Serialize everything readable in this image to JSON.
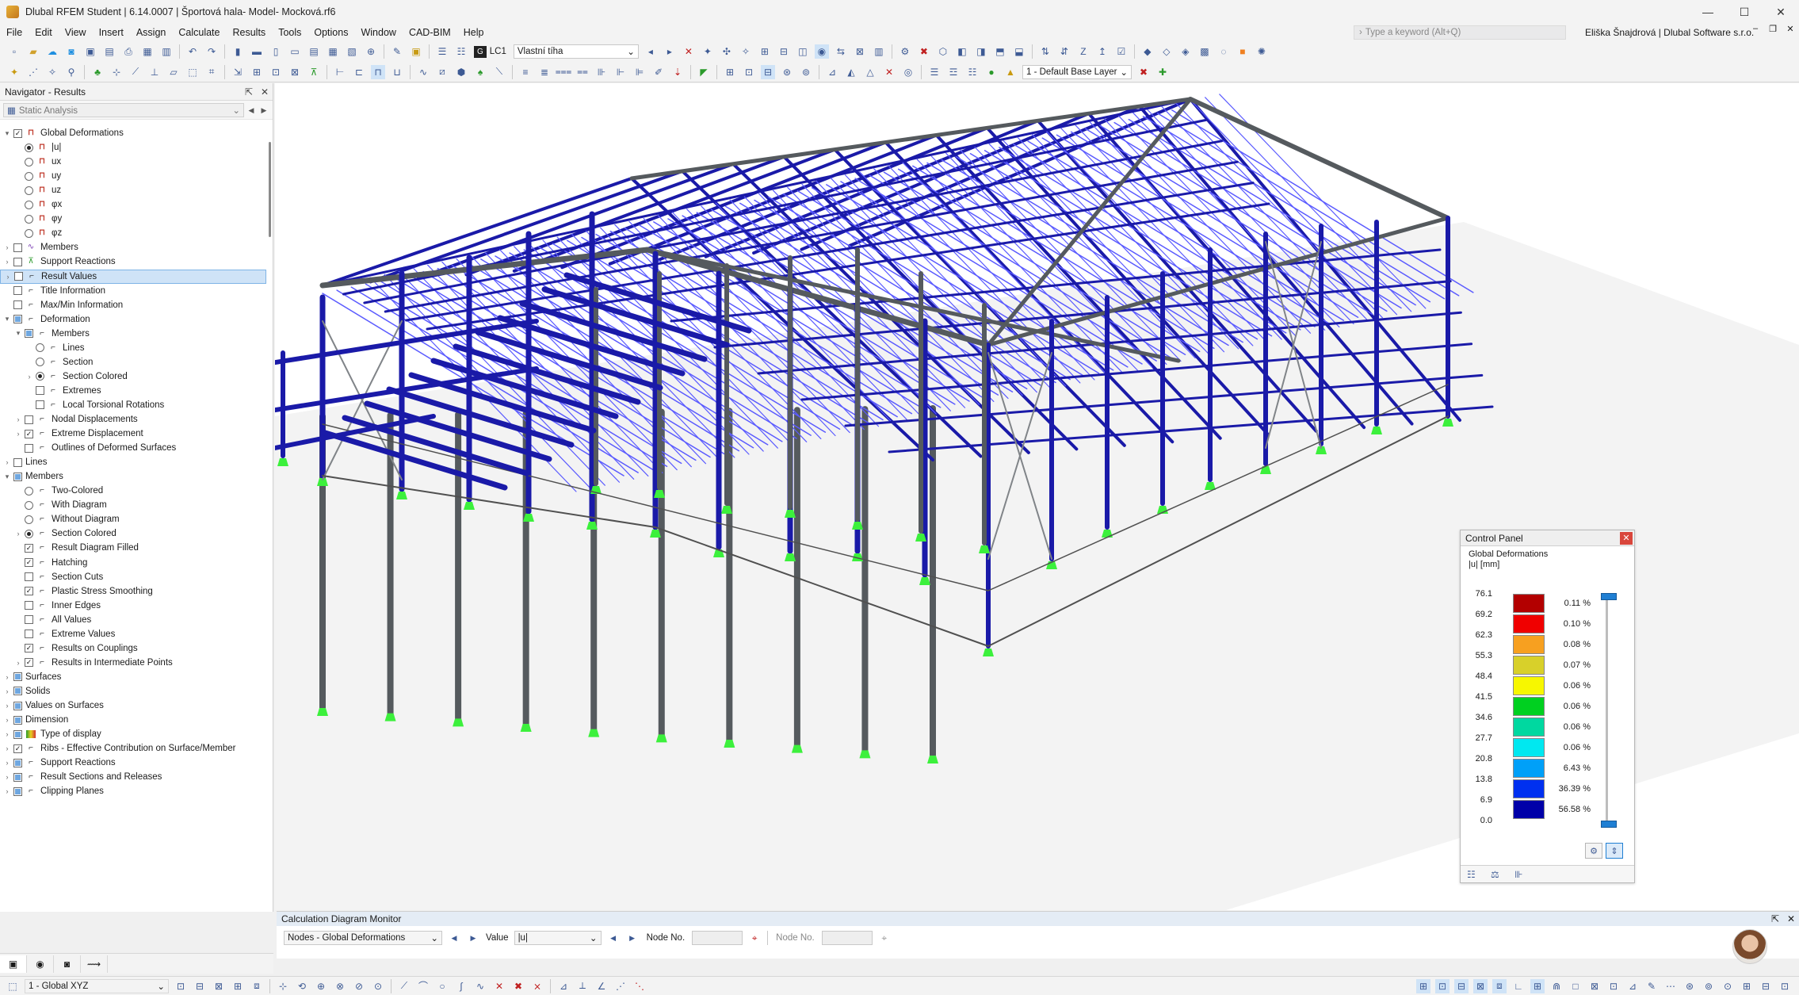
{
  "window": {
    "title": "Dlubal RFEM Student | 6.14.0007 | Športová hala- Model- Mocková.rf6",
    "controls": [
      "—",
      "☐",
      "✕"
    ]
  },
  "menu": [
    "File",
    "Edit",
    "View",
    "Insert",
    "Assign",
    "Calculate",
    "Results",
    "Tools",
    "Options",
    "Window",
    "CAD-BIM",
    "Help"
  ],
  "search": {
    "placeholder": "Type a keyword (Alt+Q)"
  },
  "user": "Eliška Šnajdrová | Dlubal Software s.r.o.",
  "toolbar": {
    "lc_badge": "G",
    "lc_code": "LC1",
    "lc_name": "Vlastní tíha",
    "layer": "1 - Default Base Layer"
  },
  "navigator": {
    "title": "Navigator - Results",
    "filter": "Static Analysis",
    "items": [
      {
        "level": 0,
        "exp": "▾",
        "ctl": "cb",
        "state": "on",
        "icon": "deform",
        "label": "Global Deformations"
      },
      {
        "level": 1,
        "exp": "",
        "ctl": "rb",
        "state": "on",
        "icon": "deform",
        "label": "|u|"
      },
      {
        "level": 1,
        "exp": "",
        "ctl": "rb",
        "state": "off",
        "icon": "deform",
        "label": "ux"
      },
      {
        "level": 1,
        "exp": "",
        "ctl": "rb",
        "state": "off",
        "icon": "deform",
        "label": "uy"
      },
      {
        "level": 1,
        "exp": "",
        "ctl": "rb",
        "state": "off",
        "icon": "deform",
        "label": "uz"
      },
      {
        "level": 1,
        "exp": "",
        "ctl": "rb",
        "state": "off",
        "icon": "deform",
        "label": "φx"
      },
      {
        "level": 1,
        "exp": "",
        "ctl": "rb",
        "state": "off",
        "icon": "deform",
        "label": "φy"
      },
      {
        "level": 1,
        "exp": "",
        "ctl": "rb",
        "state": "off",
        "icon": "deform",
        "label": "φz"
      },
      {
        "level": 0,
        "exp": "›",
        "ctl": "cb",
        "state": "off",
        "icon": "member",
        "label": "Members"
      },
      {
        "level": 0,
        "exp": "›",
        "ctl": "cb",
        "state": "off",
        "icon": "support",
        "label": "Support Reactions"
      },
      {
        "level": 0,
        "exp": "›",
        "ctl": "cb",
        "state": "off",
        "icon": "generic",
        "label": "Result Values",
        "hl": true
      },
      {
        "level": 0,
        "exp": "",
        "ctl": "cb",
        "state": "off",
        "icon": "generic",
        "label": "Title Information"
      },
      {
        "level": 0,
        "exp": "",
        "ctl": "cb",
        "state": "off",
        "icon": "generic",
        "label": "Max/Min Information"
      },
      {
        "level": 0,
        "exp": "▾",
        "ctl": "cb",
        "state": "part",
        "icon": "generic",
        "label": "Deformation"
      },
      {
        "level": 1,
        "exp": "▾",
        "ctl": "cb",
        "state": "part",
        "icon": "generic",
        "label": "Members"
      },
      {
        "level": 2,
        "exp": "",
        "ctl": "rb",
        "state": "off",
        "icon": "generic",
        "label": "Lines"
      },
      {
        "level": 2,
        "exp": "",
        "ctl": "rb",
        "state": "off",
        "icon": "generic",
        "label": "Section"
      },
      {
        "level": 2,
        "exp": "›",
        "ctl": "rb",
        "state": "on",
        "icon": "generic",
        "label": "Section Colored"
      },
      {
        "level": 2,
        "exp": "",
        "ctl": "cb",
        "state": "off",
        "icon": "generic",
        "label": "Extremes"
      },
      {
        "level": 2,
        "exp": "",
        "ctl": "cb",
        "state": "off",
        "icon": "generic",
        "label": "Local Torsional Rotations"
      },
      {
        "level": 1,
        "exp": "›",
        "ctl": "cb",
        "state": "off",
        "icon": "generic",
        "label": "Nodal Displacements"
      },
      {
        "level": 1,
        "exp": "›",
        "ctl": "cb",
        "state": "on",
        "icon": "generic",
        "label": "Extreme Displacement"
      },
      {
        "level": 1,
        "exp": "",
        "ctl": "cb",
        "state": "off",
        "icon": "generic",
        "label": "Outlines of Deformed Surfaces"
      },
      {
        "level": 0,
        "exp": "›",
        "ctl": "cb",
        "state": "off",
        "icon": "none",
        "label": "Lines"
      },
      {
        "level": 0,
        "exp": "▾",
        "ctl": "cb",
        "state": "part",
        "icon": "none",
        "label": "Members"
      },
      {
        "level": 1,
        "exp": "",
        "ctl": "rb",
        "state": "off",
        "icon": "generic",
        "label": "Two-Colored"
      },
      {
        "level": 1,
        "exp": "",
        "ctl": "rb",
        "state": "off",
        "icon": "generic",
        "label": "With Diagram"
      },
      {
        "level": 1,
        "exp": "",
        "ctl": "rb",
        "state": "off",
        "icon": "generic",
        "label": "Without Diagram"
      },
      {
        "level": 1,
        "exp": "›",
        "ctl": "rb",
        "state": "on",
        "icon": "generic",
        "label": "Section Colored"
      },
      {
        "level": 1,
        "exp": "",
        "ctl": "cb",
        "state": "on",
        "icon": "generic",
        "label": "Result Diagram Filled"
      },
      {
        "level": 1,
        "exp": "",
        "ctl": "cb",
        "state": "on",
        "icon": "generic",
        "label": "Hatching"
      },
      {
        "level": 1,
        "exp": "",
        "ctl": "cb",
        "state": "off",
        "icon": "generic",
        "label": "Section Cuts"
      },
      {
        "level": 1,
        "exp": "",
        "ctl": "cb",
        "state": "on",
        "icon": "generic",
        "label": "Plastic Stress Smoothing"
      },
      {
        "level": 1,
        "exp": "",
        "ctl": "cb",
        "state": "off",
        "icon": "generic",
        "label": "Inner Edges"
      },
      {
        "level": 1,
        "exp": "",
        "ctl": "cb",
        "state": "off",
        "icon": "generic",
        "label": "All Values"
      },
      {
        "level": 1,
        "exp": "",
        "ctl": "cb",
        "state": "off",
        "icon": "generic",
        "label": "Extreme Values"
      },
      {
        "level": 1,
        "exp": "",
        "ctl": "cb",
        "state": "on",
        "icon": "generic",
        "label": "Results on Couplings"
      },
      {
        "level": 1,
        "exp": "›",
        "ctl": "cb",
        "state": "on",
        "icon": "generic",
        "label": "Results in Intermediate Points"
      },
      {
        "level": 0,
        "exp": "›",
        "ctl": "cb",
        "state": "part",
        "icon": "none",
        "label": "Surfaces"
      },
      {
        "level": 0,
        "exp": "›",
        "ctl": "cb",
        "state": "part",
        "icon": "none",
        "label": "Solids"
      },
      {
        "level": 0,
        "exp": "›",
        "ctl": "cb",
        "state": "part",
        "icon": "none",
        "label": "Values on Surfaces"
      },
      {
        "level": 0,
        "exp": "›",
        "ctl": "cb",
        "state": "part",
        "icon": "none",
        "label": "Dimension"
      },
      {
        "level": 0,
        "exp": "›",
        "ctl": "cb",
        "state": "part",
        "icon": "colors",
        "label": "Type of display"
      },
      {
        "level": 0,
        "exp": "›",
        "ctl": "cb",
        "state": "on",
        "icon": "generic",
        "label": "Ribs - Effective Contribution on Surface/Member"
      },
      {
        "level": 0,
        "exp": "›",
        "ctl": "cb",
        "state": "part",
        "icon": "generic",
        "label": "Support Reactions"
      },
      {
        "level": 0,
        "exp": "›",
        "ctl": "cb",
        "state": "part",
        "icon": "generic",
        "label": "Result Sections and Releases"
      },
      {
        "level": 0,
        "exp": "›",
        "ctl": "cb",
        "state": "part",
        "icon": "generic",
        "label": "Clipping Planes"
      }
    ]
  },
  "control_panel": {
    "title": "Control Panel",
    "result_name": "Global Deformations",
    "unit": "|u| [mm]",
    "legend": [
      {
        "value": "76.1",
        "color": "#b30000",
        "pct": "0.11 %"
      },
      {
        "value": "69.2",
        "color": "#f00000",
        "pct": "0.10 %"
      },
      {
        "value": "62.3",
        "color": "#f7a020",
        "pct": "0.08 %"
      },
      {
        "value": "55.3",
        "color": "#d8d02a",
        "pct": "0.07 %"
      },
      {
        "value": "48.4",
        "color": "#f7f700",
        "pct": "0.06 %"
      },
      {
        "value": "41.5",
        "color": "#00d020",
        "pct": "0.06 %"
      },
      {
        "value": "34.6",
        "color": "#00d8a0",
        "pct": "0.06 %"
      },
      {
        "value": "27.7",
        "color": "#00e8f0",
        "pct": "0.06 %"
      },
      {
        "value": "20.8",
        "color": "#00a0f8",
        "pct": "6.43 %"
      },
      {
        "value": "13.8",
        "color": "#0030f0",
        "pct": "36.39 %"
      },
      {
        "value": "6.9",
        "color": "#0000a8",
        "pct": "56.58 %"
      },
      {
        "value": "0.0",
        "color": "",
        "pct": ""
      }
    ]
  },
  "monitor": {
    "title": "Calculation Diagram Monitor",
    "object_type": "Nodes - Global Deformations",
    "value_label": "Value",
    "value": "|u|",
    "node_label": "Node No.",
    "node_label2": "Node No."
  },
  "statusbar": {
    "view": "1 - Global XYZ"
  },
  "colors": {
    "accent": "#1f7fd3",
    "member_blue": "#1a1aa8",
    "bracing_blue": "#5b5bff",
    "grey_member": "#555a5e",
    "support": "#3cf03c"
  }
}
